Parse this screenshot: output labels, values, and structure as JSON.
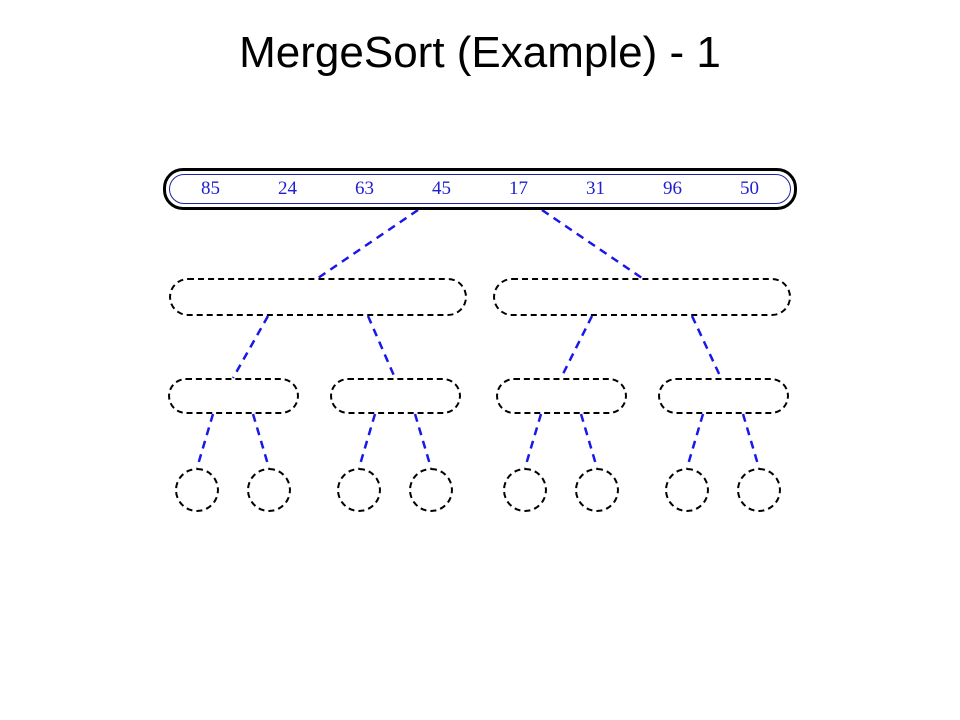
{
  "title": "MergeSort (Example) - 1",
  "values": {
    "v0": "85",
    "v1": "24",
    "v2": "63",
    "v3": "45",
    "v4": "17",
    "v5": "31",
    "v6": "96",
    "v7": "50"
  },
  "chart_data": {
    "type": "tree-diagram",
    "description": "Recursion tree for merge sort, step 1: the full array is shown at the root; lower levels are empty placeholders connected by dashed lines.",
    "root_values": [
      85,
      24,
      63,
      45,
      17,
      31,
      96,
      50
    ],
    "levels": 4,
    "nodes_per_level": [
      1,
      2,
      4,
      8
    ]
  }
}
